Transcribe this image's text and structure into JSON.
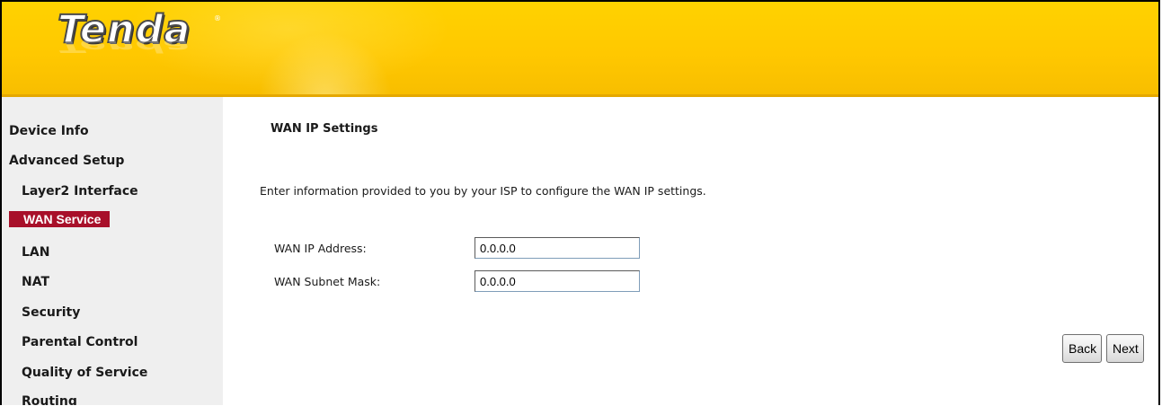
{
  "header": {
    "logo_text": "Tenda",
    "logo_mark": "®",
    "colors": {
      "header_bg": "#ffc800",
      "active_item_bg": "#a8102a",
      "sidebar_bg": "#efefef"
    }
  },
  "sidebar": {
    "items": [
      {
        "label": "Device Info"
      },
      {
        "label": "Advanced Setup"
      },
      {
        "label": "Layer2 Interface"
      },
      {
        "label": "WAN Service"
      },
      {
        "label": "LAN"
      },
      {
        "label": "NAT"
      },
      {
        "label": "Security"
      },
      {
        "label": "Parental Control"
      },
      {
        "label": "Quality of Service"
      },
      {
        "label": "Routing"
      }
    ]
  },
  "main": {
    "title": "WAN IP Settings",
    "description": "Enter information provided to you by your ISP to configure the WAN IP settings.",
    "fields": [
      {
        "label": "WAN IP Address:",
        "value": "0.0.0.0"
      },
      {
        "label": "WAN Subnet Mask:",
        "value": "0.0.0.0"
      }
    ],
    "buttons": {
      "back": "Back",
      "next": "Next"
    }
  }
}
